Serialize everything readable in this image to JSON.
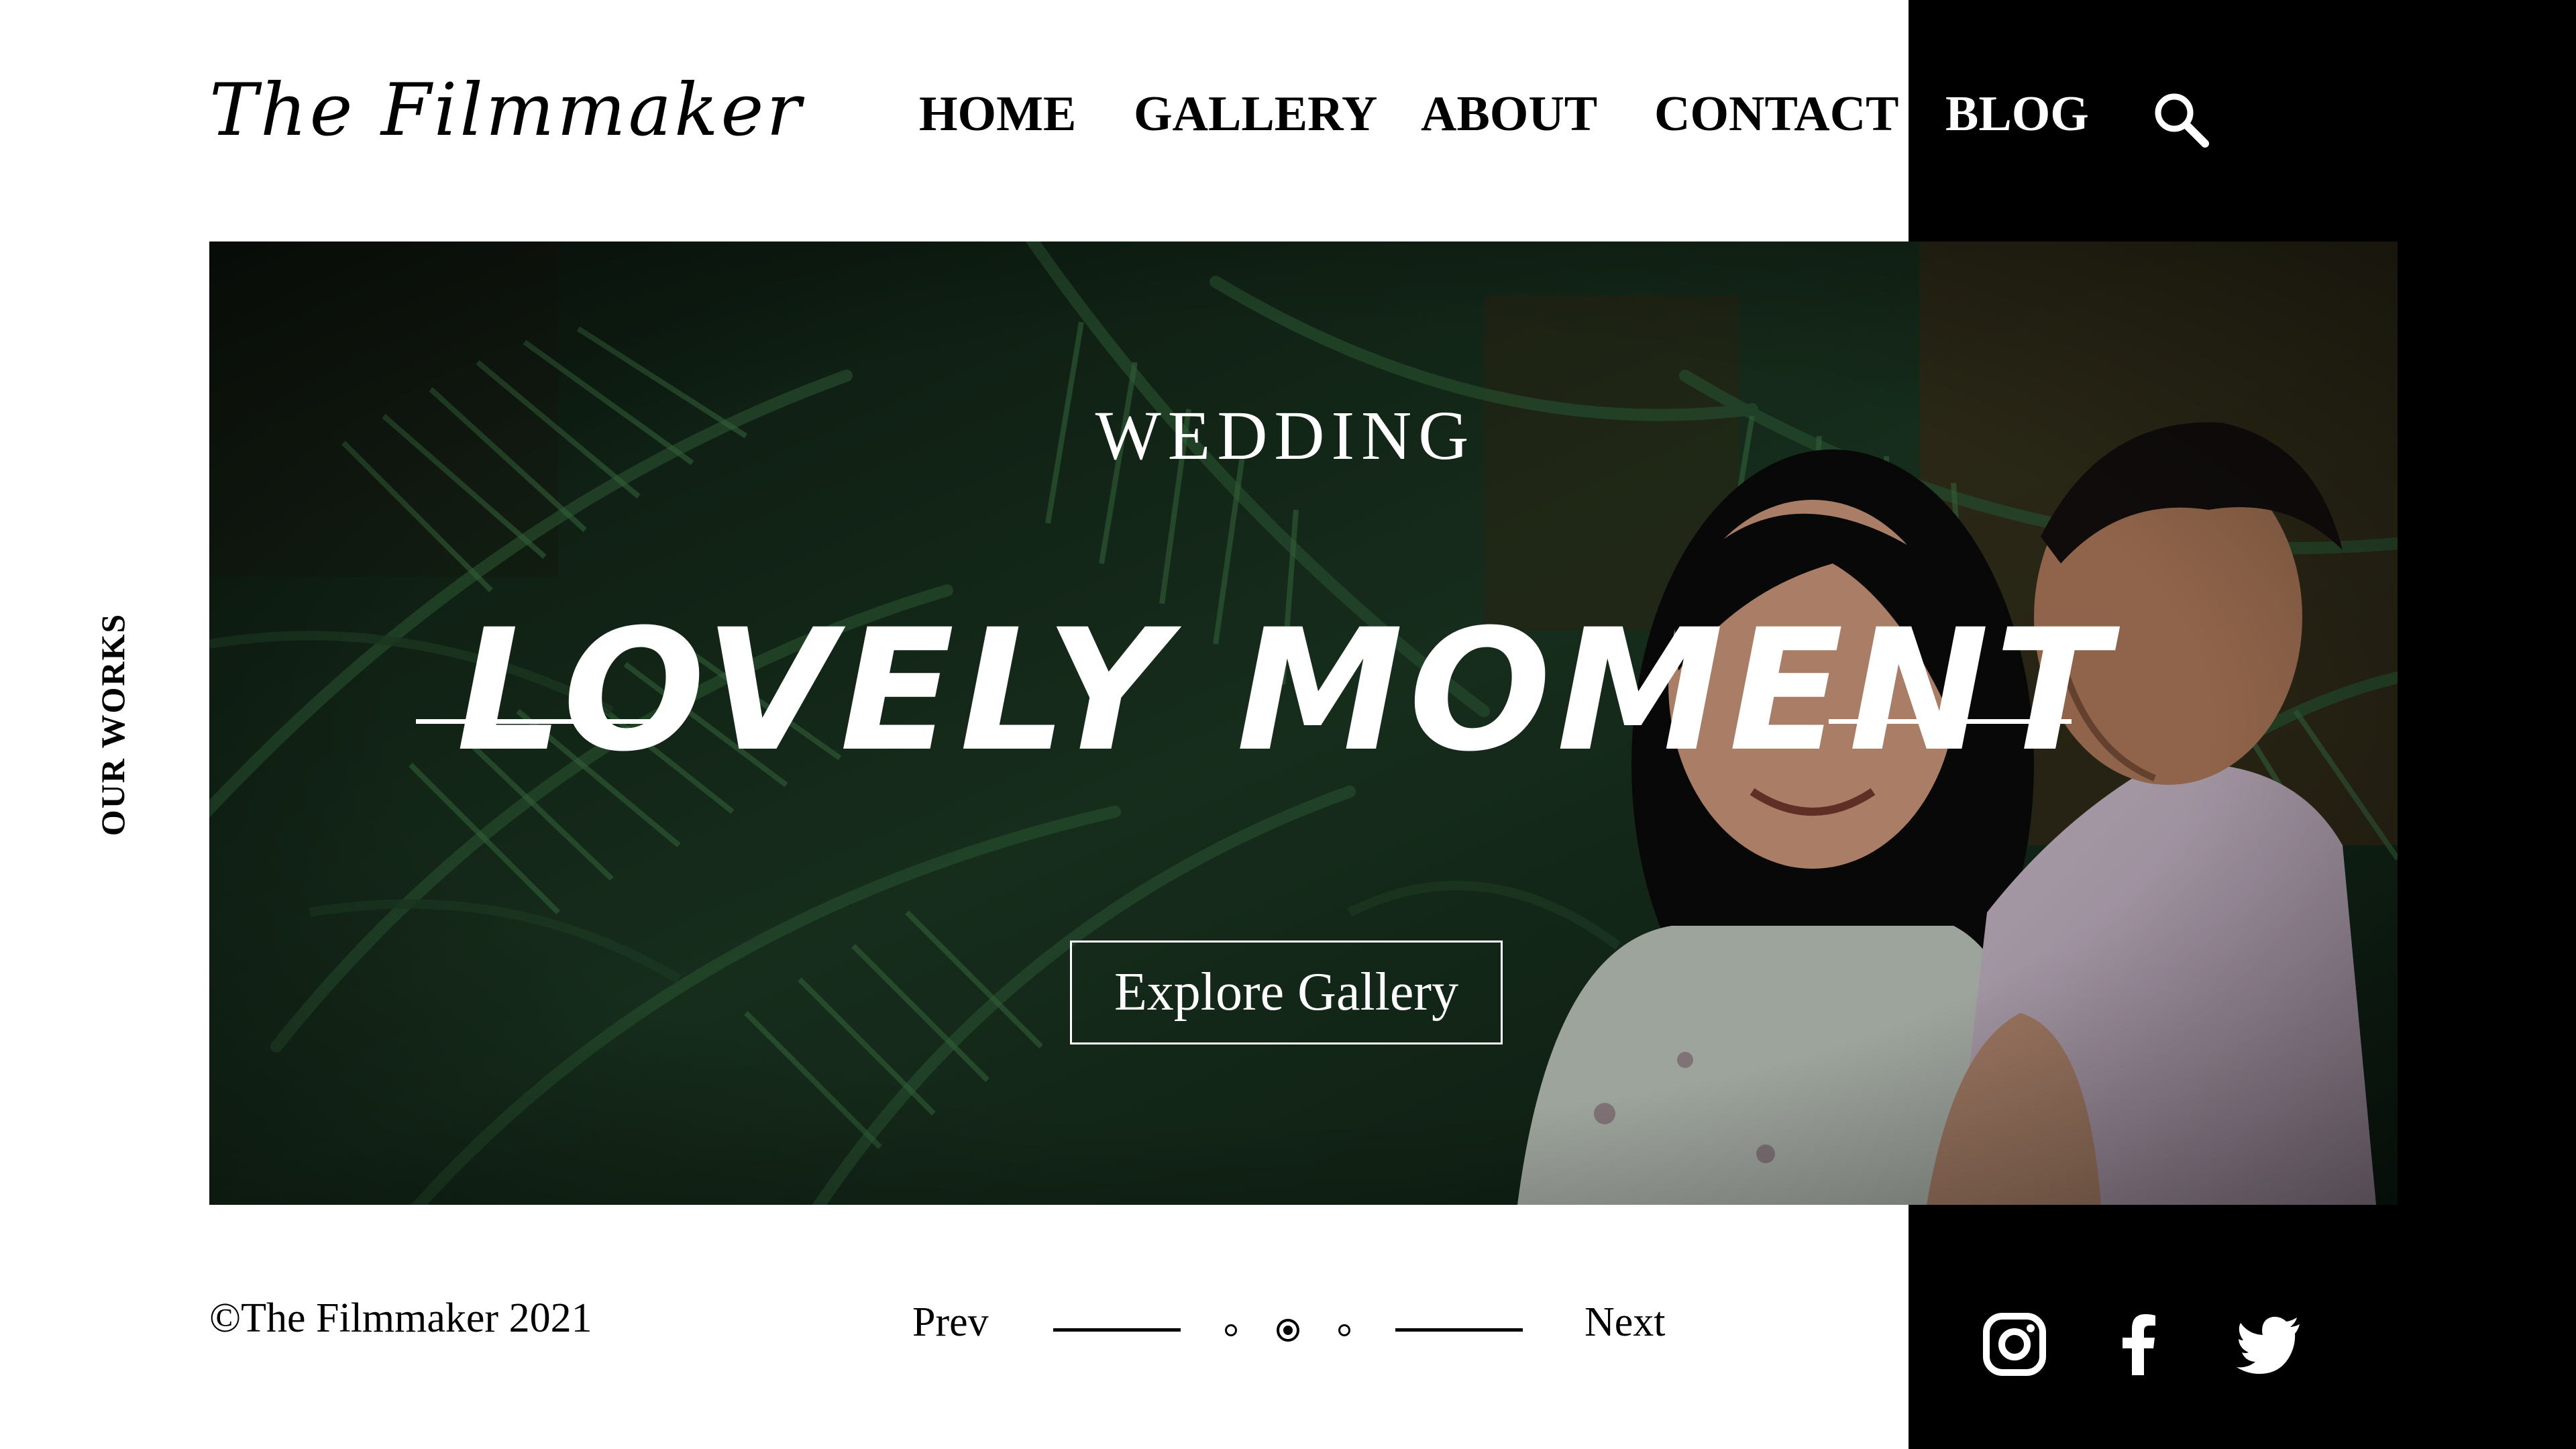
{
  "brand": {
    "logo": "The Filmmaker"
  },
  "nav": {
    "items": [
      {
        "label": "HOME"
      },
      {
        "label": "GALLERY"
      },
      {
        "label": "ABOUT"
      },
      {
        "label": "CONTACT"
      },
      {
        "label": "BLOG"
      }
    ],
    "search_icon": "search-icon"
  },
  "side": {
    "vertical_label": "OUR WORKS"
  },
  "hero": {
    "category": "WEDDING",
    "headline": "LOVELY MOMENT",
    "button_label": "Explore Gallery",
    "image_description_icon": "hero-photo"
  },
  "footer": {
    "copyright": "©The Filmmaker 2021",
    "prev_label": "Prev",
    "next_label": "Next",
    "pagination": {
      "total": 3,
      "active_index": 1
    },
    "social_icons": [
      "instagram-icon",
      "facebook-icon",
      "twitter-icon"
    ]
  },
  "colors": {
    "background": "#ffffff",
    "accent_panel": "#000000",
    "text_light": "#ffffff",
    "text_dark": "#000000",
    "foliage": "#1f3d26"
  }
}
